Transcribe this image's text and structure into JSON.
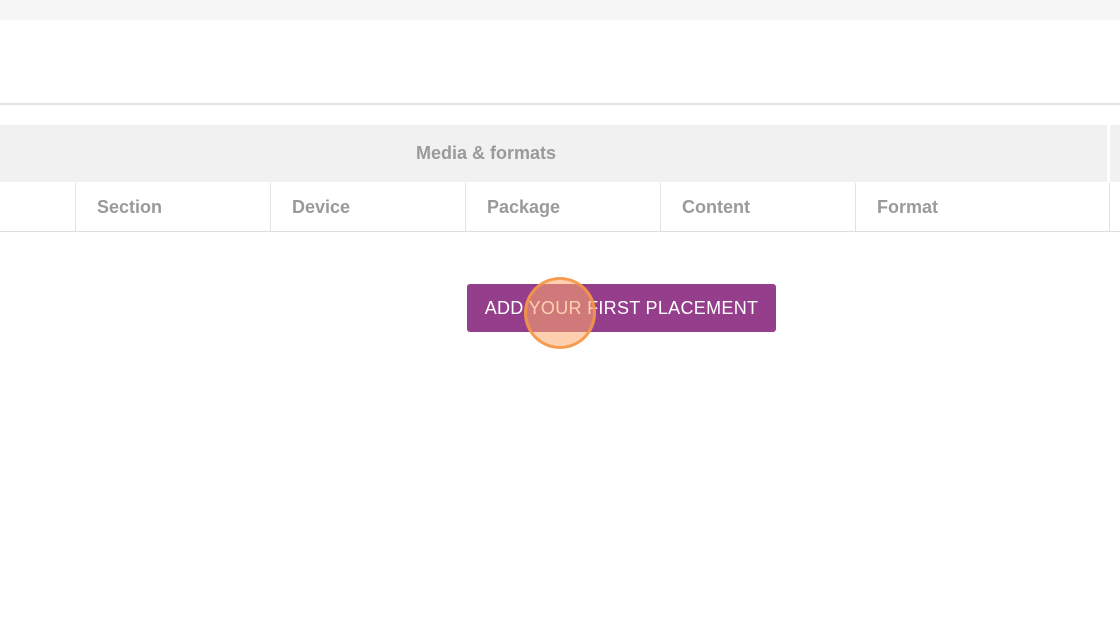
{
  "table": {
    "group_header": "Media & formats",
    "columns": [
      "",
      "Section",
      "Device",
      "Package",
      "Content",
      "Format",
      ""
    ]
  },
  "empty_state": {
    "add_button_label": "ADD YOUR FIRST PLACEMENT"
  },
  "colors": {
    "button_background": "#953e8c",
    "header_text": "#9a9a9a",
    "group_header_background": "#f1f1f1",
    "click_indicator": "#f5964a"
  }
}
